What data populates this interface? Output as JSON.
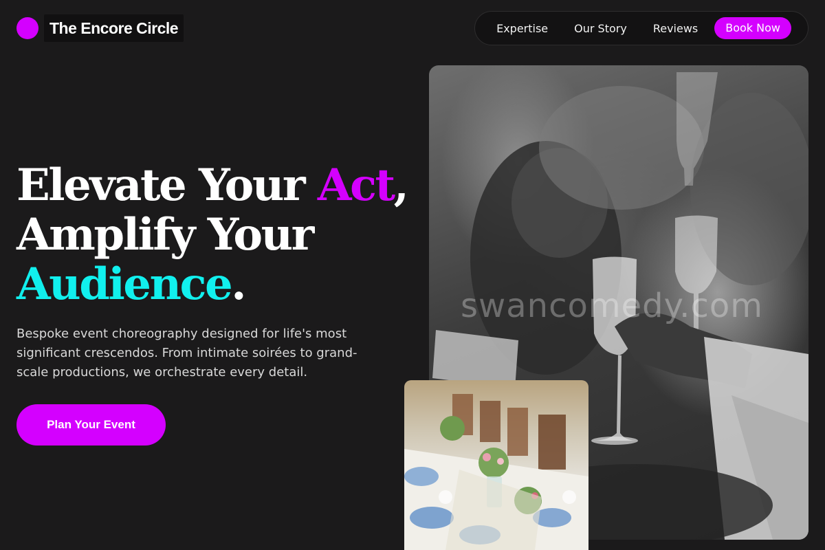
{
  "brand": {
    "name": "The Encore Circle"
  },
  "nav": {
    "links": [
      "Expertise",
      "Our Story",
      "Reviews"
    ],
    "cta": "Book Now"
  },
  "hero": {
    "headline": {
      "part1": "Elevate Your ",
      "accent1": "Act",
      "part2": ",",
      "line2": "Amplify Your",
      "accent2": "Audience",
      "part3": "."
    },
    "lede": "Bespoke event choreography designed for life's most significant crescendos. From intimate soirées to grand-scale productions, we orchestrate every detail.",
    "cta": "Plan Your Event"
  },
  "media": {
    "main_watermark": "swancomedy.com"
  },
  "colors": {
    "background": "#1b1a1b",
    "accent_purple": "#d400ff",
    "accent_cyan": "#11f0ee"
  }
}
